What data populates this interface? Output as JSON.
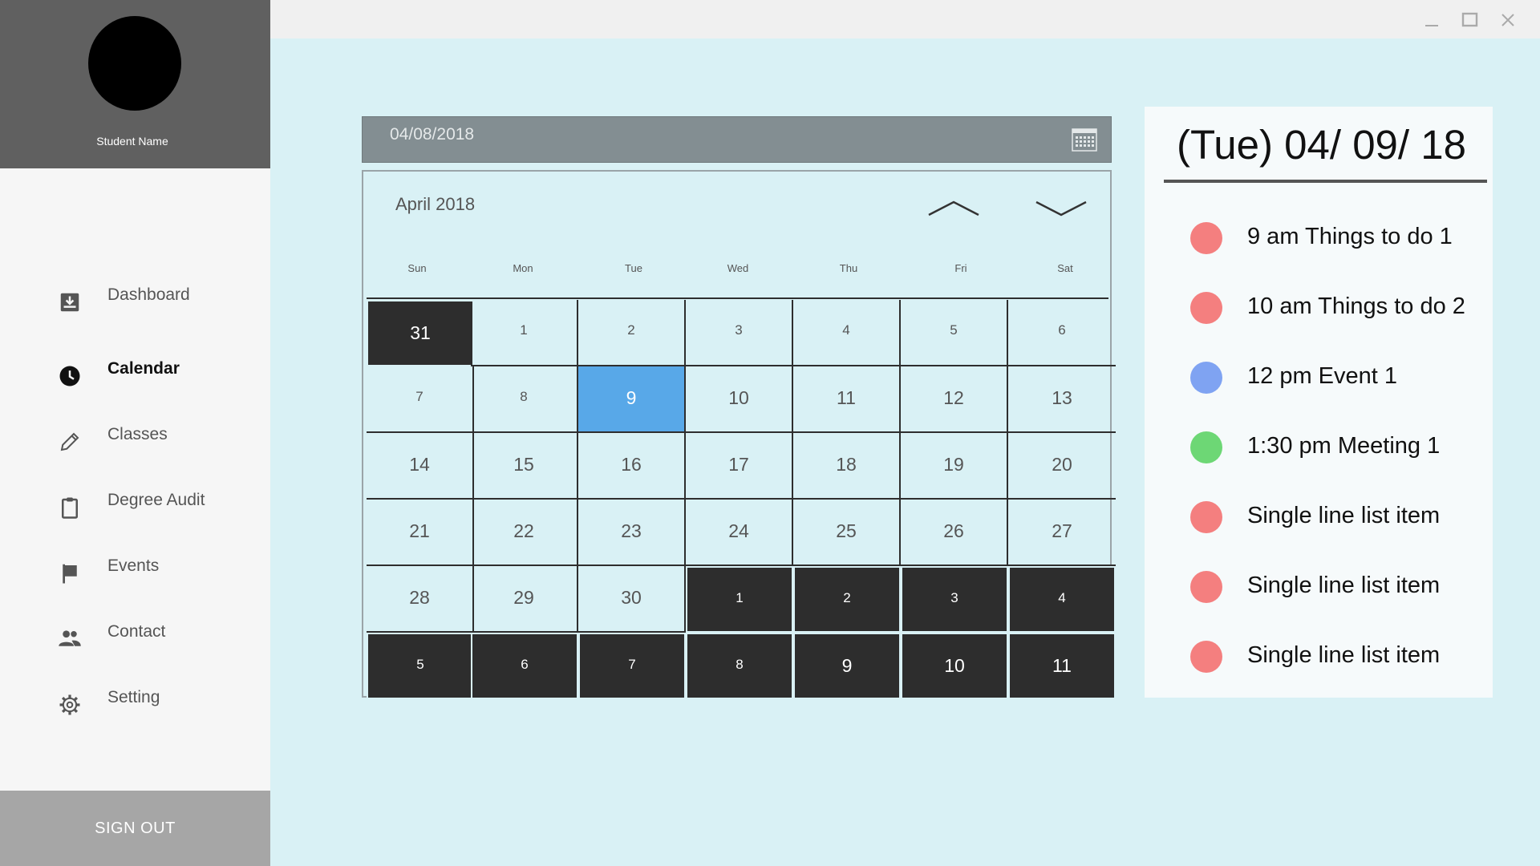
{
  "profile": {
    "name": "Student Name"
  },
  "nav": [
    {
      "label": "Dashboard",
      "icon": "download-box-icon"
    },
    {
      "label": "Calendar",
      "icon": "clock-icon",
      "active": true
    },
    {
      "label": "Classes",
      "icon": "pencil-icon"
    },
    {
      "label": "Degree Audit",
      "icon": "clipboard-icon"
    },
    {
      "label": "Events",
      "icon": "flag-icon"
    },
    {
      "label": "Contact",
      "icon": "people-icon"
    },
    {
      "label": "Setting",
      "icon": "gear-icon"
    }
  ],
  "signout_label": "SIGN OUT",
  "date_field": {
    "value": "04/08/2018",
    "icon": "calendar-icon"
  },
  "calendar": {
    "month_label": "April 2018",
    "days_of_week": [
      "Sun",
      "Mon",
      "Tue",
      "Wed",
      "Thu",
      "Fri",
      "Sat"
    ],
    "weeks": [
      [
        "31",
        "1",
        "2",
        "3",
        "4",
        "5",
        "6"
      ],
      [
        "7",
        "8",
        "9",
        "10",
        "11",
        "12",
        "13"
      ],
      [
        "14",
        "15",
        "16",
        "17",
        "18",
        "19",
        "20"
      ],
      [
        "21",
        "22",
        "23",
        "24",
        "25",
        "26",
        "27"
      ],
      [
        "28",
        "29",
        "30",
        "1",
        "2",
        "3",
        "4"
      ],
      [
        "5",
        "6",
        "7",
        "8",
        "9",
        "10",
        "11"
      ]
    ],
    "selected_day": "9"
  },
  "agenda": {
    "date_label": "(Tue) 04/ 09/ 18",
    "items": [
      {
        "text": "9 am Things to do 1",
        "color": "#f47f7f"
      },
      {
        "text": "10 am Things to do 2",
        "color": "#f47f7f"
      },
      {
        "text": "12 pm Event 1",
        "color": "#7fa3f2"
      },
      {
        "text": "1:30 pm Meeting 1",
        "color": "#6dd775"
      },
      {
        "text": "Single line list item",
        "color": "#f47f7f"
      },
      {
        "text": "Single line list item",
        "color": "#f47f7f"
      },
      {
        "text": "Single line list item",
        "color": "#f47f7f"
      }
    ]
  },
  "colors": {
    "background": "#d9f1f5",
    "selected": "#58a8e8",
    "other_month": "#2d2d2d"
  }
}
